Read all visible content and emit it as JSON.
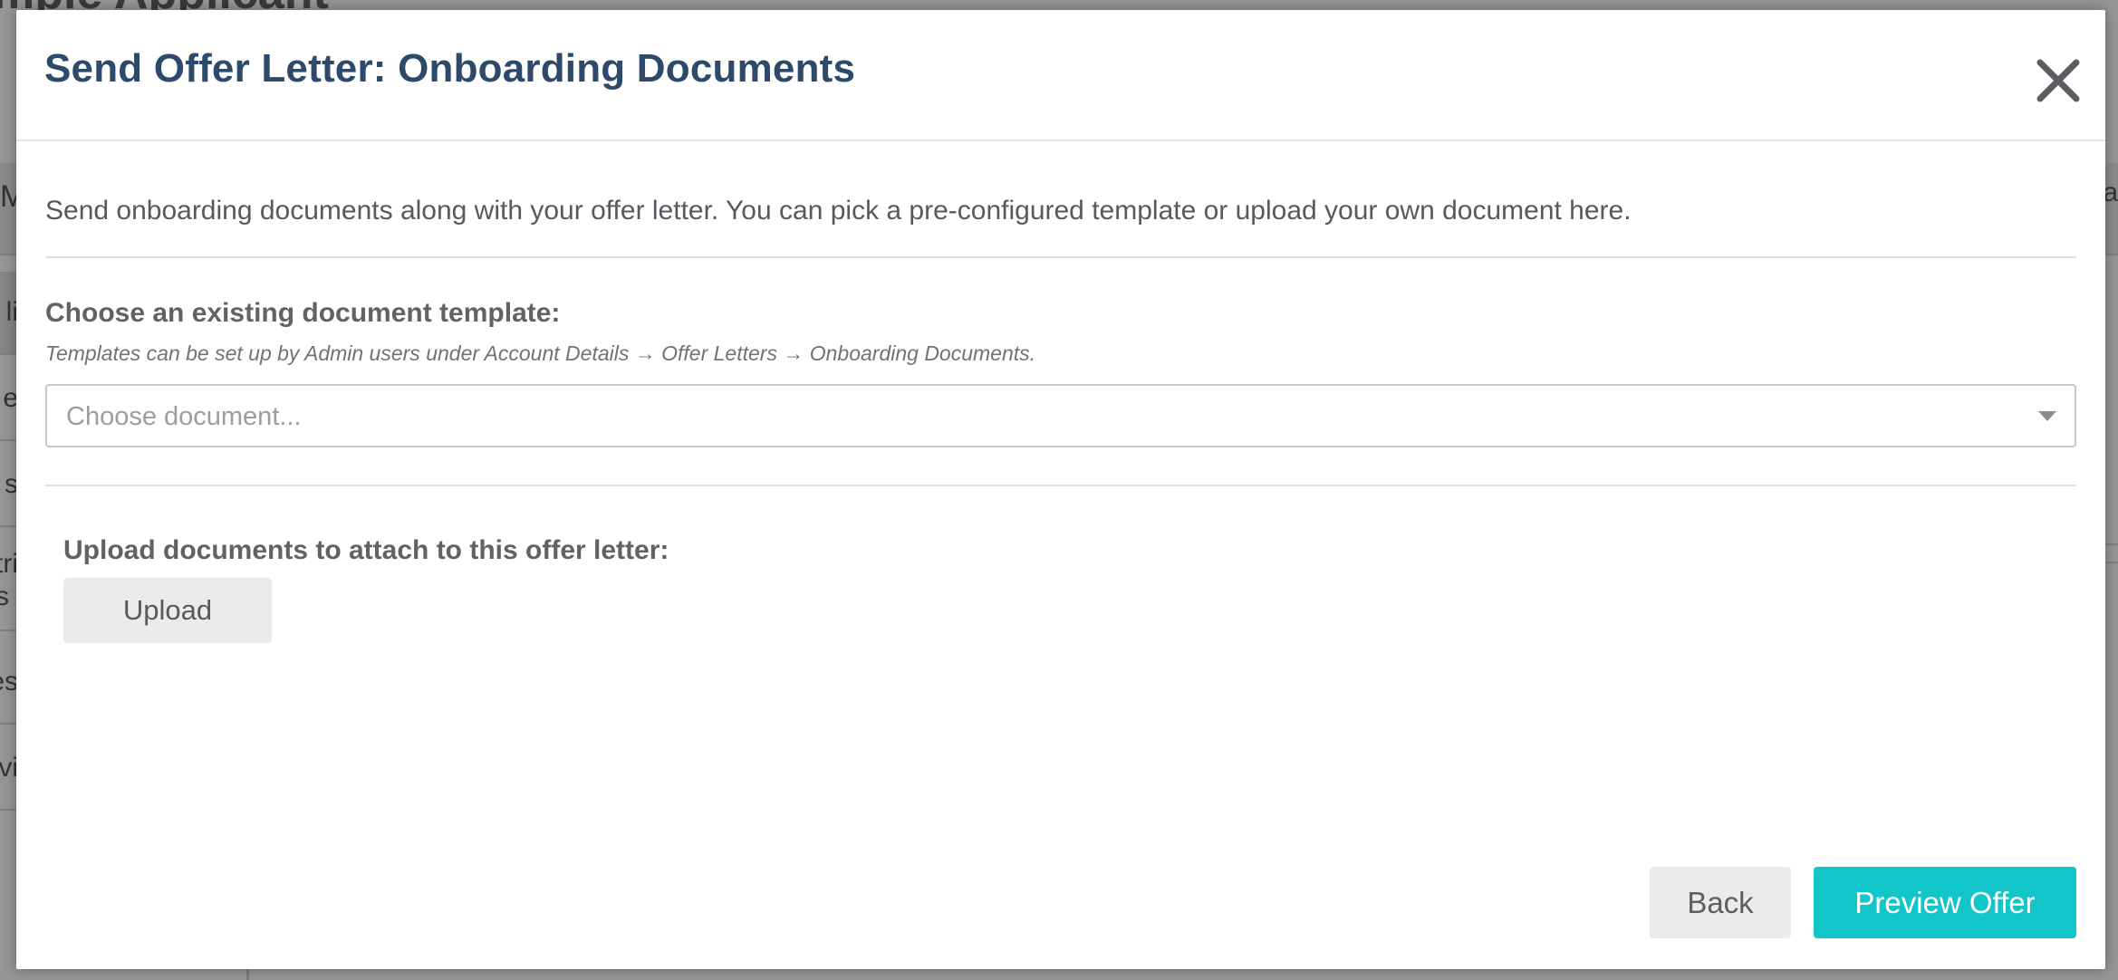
{
  "background": {
    "page_title": "mple Applicant",
    "top_left_fragment": "M",
    "top_right_fragment": "a",
    "sidebar_fragments": [
      "li",
      "e",
      "s",
      "tri\ns",
      "es",
      "vi"
    ]
  },
  "modal": {
    "title": "Send Offer Letter: Onboarding Documents",
    "close_icon": "close-icon",
    "intro": "Send onboarding documents along with your offer letter. You can pick a pre-configured template or upload your own document here.",
    "template_section": {
      "label": "Choose an existing document template:",
      "hint": "Templates can be set up by Admin users under Account Details → Offer Letters → Onboarding Documents.",
      "select_placeholder": "Choose document..."
    },
    "upload_section": {
      "label": "Upload documents to attach to this offer letter:",
      "button_label": "Upload"
    },
    "footer": {
      "back_label": "Back",
      "preview_label": "Preview Offer"
    }
  },
  "colors": {
    "title": "#2e4a6b",
    "primary_button": "#12c5c8",
    "secondary_button": "#ebebeb"
  }
}
